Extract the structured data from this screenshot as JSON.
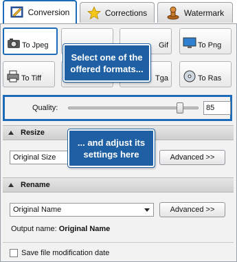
{
  "tabs": [
    {
      "label": "Conversion",
      "icon": "conversion-icon",
      "active": true
    },
    {
      "label": "Corrections",
      "icon": "star-icon",
      "active": false
    },
    {
      "label": "Watermark",
      "icon": "stamp-icon",
      "active": false
    }
  ],
  "formats": {
    "jpeg": "To Jpeg",
    "gif_partial": "Gif",
    "png": "To Png",
    "tiff": "To Tiff",
    "tga_partial": "Tga",
    "ras": "To Ras"
  },
  "callouts": {
    "formats": "Select one of the offered formats...",
    "settings": "... and adjust its settings here"
  },
  "quality": {
    "label": "Quality:",
    "value": "85",
    "slider_level": 0.85
  },
  "resize": {
    "header": "Resize",
    "combo_value": "Original Size",
    "advanced": "Advanced >>"
  },
  "rename": {
    "header": "Rename",
    "combo_value": "Original Name",
    "advanced": "Advanced >>",
    "output_label": "Output name:",
    "output_value": "Original Name"
  },
  "footer": {
    "checkbox_label": "Save file modification date",
    "checked": false
  },
  "colors": {
    "accent": "#1c6bb8",
    "callout": "#1f5fa3"
  }
}
